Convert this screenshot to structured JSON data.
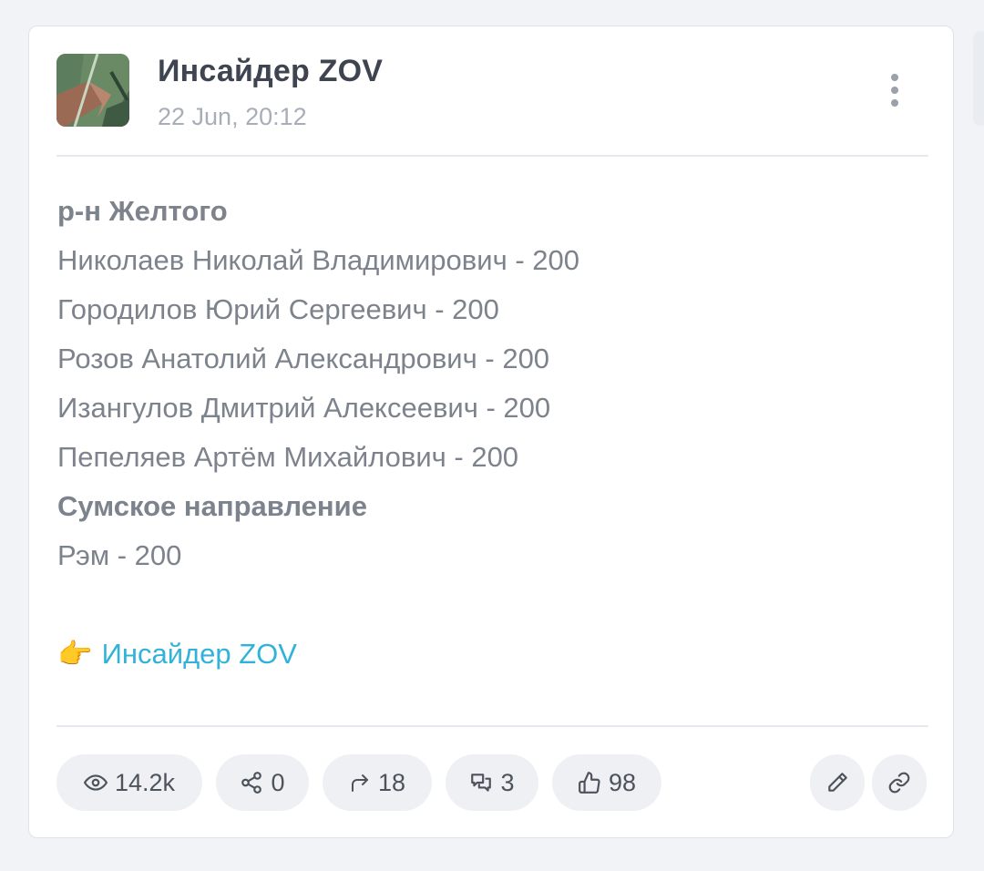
{
  "post": {
    "channel_name": "Инсайдер ZOV",
    "timestamp": "22 Jun, 20:12",
    "lines": {
      "heading1": "р-н Желтого",
      "l1": "Николаев Николай Владимирович - 200",
      "l2": "Городилов Юрий Сергеевич - 200",
      "l3": "Розов Анатолий Александрович - 200",
      "l4": "Изангулов Дмитрий Алексеевич - 200",
      "l5": "Пепеляев Артём Михайлович - 200",
      "heading2": "Сумское направление",
      "l6": "Рэм - 200"
    },
    "link": {
      "emoji": "👉",
      "text": "Инсайдер ZOV"
    }
  },
  "stats": {
    "views": "14.2k",
    "shares": "0",
    "forwards": "18",
    "comments": "3",
    "reactions": "98"
  },
  "colors": {
    "link": "#31b3d9",
    "text": "#7d838c",
    "title": "#3f4550",
    "pill_bg": "#eef0f3"
  },
  "icons": [
    "channel-avatar",
    "more-vertical-icon",
    "eye-icon",
    "share-nodes-icon",
    "forward-arrow-icon",
    "comments-icon",
    "thumbs-up-icon",
    "pencil-icon",
    "link-icon"
  ]
}
